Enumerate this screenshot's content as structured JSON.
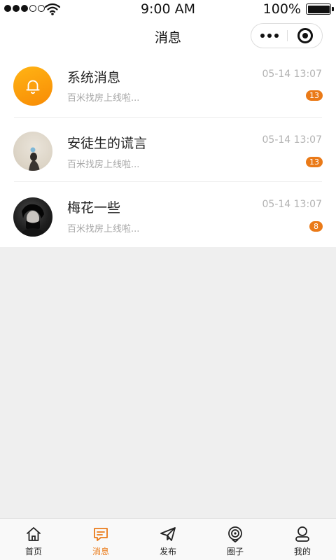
{
  "status_bar": {
    "time": "9:00 AM",
    "battery": "100%"
  },
  "nav": {
    "title": "消息"
  },
  "conversations": [
    {
      "name": "系统消息",
      "time": "05-14  13:07",
      "preview": "百米找房上线啦...",
      "unread": "13",
      "avatar": "bell-icon"
    },
    {
      "name": "安徒生的谎言",
      "time": "05-14  13:07",
      "preview": "百米找房上线啦...",
      "unread": "13",
      "avatar": "user-photo"
    },
    {
      "name": "梅花一些",
      "time": "05-14  13:07",
      "preview": "百米找房上线啦...",
      "unread": "8",
      "avatar": "user-photo"
    }
  ],
  "tabs": [
    {
      "label": "首页",
      "icon": "home-icon",
      "active": false
    },
    {
      "label": "消息",
      "icon": "message-icon",
      "active": true
    },
    {
      "label": "发布",
      "icon": "send-icon",
      "active": false
    },
    {
      "label": "圈子",
      "icon": "circle-icon",
      "active": false
    },
    {
      "label": "我的",
      "icon": "profile-icon",
      "active": false
    }
  ],
  "colors": {
    "accent": "#ea7a18",
    "bell_gradient": [
      "#ffb414",
      "#f88b05"
    ],
    "background": "#efefef"
  }
}
